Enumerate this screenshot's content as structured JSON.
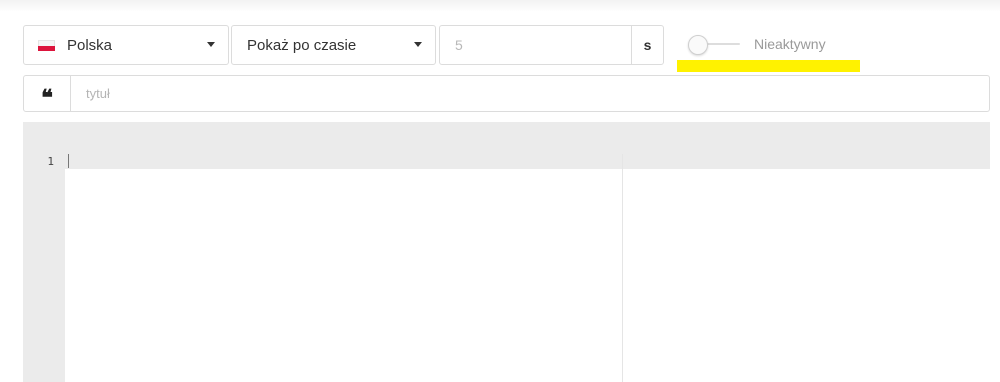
{
  "language_select": {
    "selected": "Polska",
    "flag_icon": "poland-flag-icon",
    "flag_colors": {
      "top": "#f5f5f5",
      "bottom": "#dc143c"
    }
  },
  "mode_select": {
    "selected": "Pokaż po czasie"
  },
  "delay_input": {
    "value": "",
    "placeholder": "5",
    "unit": "s"
  },
  "active_toggle": {
    "state": false,
    "label": "Nieaktywny",
    "highlight_color": "#fff200"
  },
  "title_field": {
    "icon": "quote-icon",
    "icon_glyph": "❝",
    "value": "",
    "placeholder": "tytuł"
  },
  "editor": {
    "line_numbers": [
      "1"
    ],
    "content": ""
  }
}
